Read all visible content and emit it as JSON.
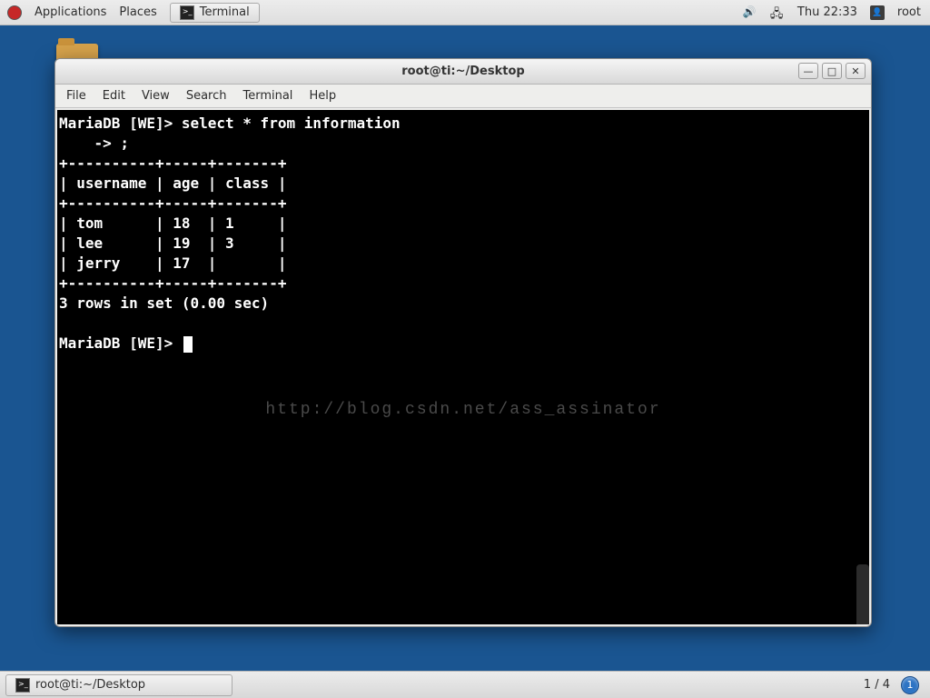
{
  "top_panel": {
    "applications": "Applications",
    "places": "Places",
    "active_app": "Terminal",
    "clock": "Thu 22:33",
    "user": "root"
  },
  "window": {
    "title": "root@ti:~/Desktop",
    "menu": {
      "file": "File",
      "edit": "Edit",
      "view": "View",
      "search": "Search",
      "terminal": "Terminal",
      "help": "Help"
    },
    "controls": {
      "min": "—",
      "max": "□",
      "close": "✕"
    }
  },
  "terminal": {
    "prompt1": "MariaDB [WE]> select * from information",
    "prompt1cont": "    -> ;",
    "table_border": "+----------+-----+-------+",
    "table_header": "| username | age | class |",
    "row1": "| tom      | 18  | 1     |",
    "row2": "| lee      | 19  | 3     |",
    "row3": "| jerry    | 17  |       |",
    "result": "3 rows in set (0.00 sec)",
    "prompt2": "MariaDB [WE]> ",
    "watermark": "http://blog.csdn.net/ass_assinator"
  },
  "bottom_panel": {
    "task": "root@ti:~/Desktop",
    "pager": "1 / 4",
    "badge": "1"
  }
}
